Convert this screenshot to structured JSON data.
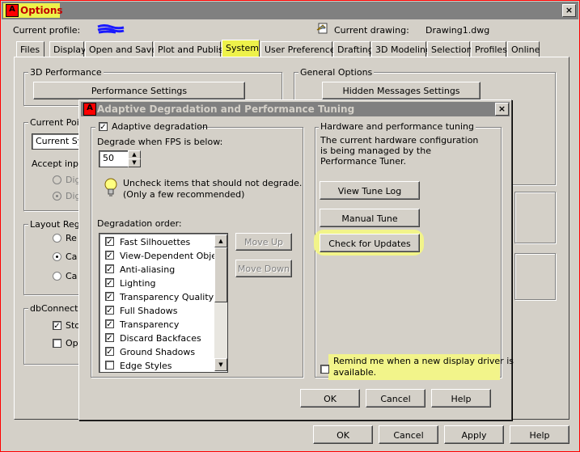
{
  "window": {
    "title": "Options",
    "icon_letter": "A",
    "close_glyph": "×"
  },
  "profile": {
    "label": "Current profile:",
    "current_drawing_label": "Current drawing:",
    "current_drawing_value": "Drawing1.dwg"
  },
  "tabs": [
    {
      "label": "Files",
      "active": false
    },
    {
      "label": "Display",
      "active": false
    },
    {
      "label": "Open and Save",
      "active": false
    },
    {
      "label": "Plot and Publish",
      "active": false
    },
    {
      "label": "System",
      "active": true
    },
    {
      "label": "User Preferences",
      "active": false
    },
    {
      "label": "Drafting",
      "active": false
    },
    {
      "label": "3D Modeling",
      "active": false
    },
    {
      "label": "Selection",
      "active": false
    },
    {
      "label": "Profiles",
      "active": false
    },
    {
      "label": "Online",
      "active": false
    }
  ],
  "system_tab": {
    "perf_group": "3D Performance",
    "perf_settings_btn": "Performance Settings",
    "general_group": "General Options",
    "hidden_messages_btn": "Hidden Messages Settings",
    "current_pointing_group": "Current Poin",
    "current_pointing_value": "Current Sys",
    "accept_input_label": "Accept inpu",
    "accept_opt1": "Dig",
    "accept_opt2": "Dig",
    "layout_group": "Layout Rege",
    "layout_opt1": "Re",
    "layout_opt2": "Ca",
    "layout_opt3": "Ca",
    "dbconnect_group": "dbConnect O",
    "dbconnect_opt1": "Sto",
    "dbconnect_opt2": "Op"
  },
  "dialog": {
    "title": "Adaptive Degradation and Performance Tuning",
    "icon_letter": "A",
    "close_glyph": "×",
    "adaptive_label": "Adaptive degradation",
    "adaptive_checked": true,
    "fps_label": "Degrade when FPS is below:",
    "fps_value": "50",
    "hint_line1": "Uncheck items that should not degrade.",
    "hint_line2": "(Only a few recommended)",
    "order_label": "Degradation order:",
    "items": [
      {
        "label": "Fast Silhouettes",
        "checked": true
      },
      {
        "label": "View-Dependent Objects",
        "checked": true
      },
      {
        "label": "Anti-aliasing",
        "checked": true
      },
      {
        "label": "Lighting",
        "checked": true
      },
      {
        "label": "Transparency Quality",
        "checked": true
      },
      {
        "label": "Full Shadows",
        "checked": true
      },
      {
        "label": "Transparency",
        "checked": true
      },
      {
        "label": "Discard Backfaces",
        "checked": true
      },
      {
        "label": "Ground Shadows",
        "checked": true
      },
      {
        "label": "Edge Styles",
        "checked": false
      }
    ],
    "move_up": "Move Up",
    "move_down": "Move Down",
    "hw_group": "Hardware and performance tuning",
    "hw_line1": "The current hardware configuration",
    "hw_line2": "is being managed by the",
    "hw_line3": "Performance Tuner.",
    "view_log_btn": "View Tune Log",
    "manual_tune_btn": "Manual Tune",
    "check_updates_btn": "Check for Updates",
    "remind_line1": "Remind me when a new display driver is",
    "remind_line2": "available.",
    "remind_checked": false,
    "ok": "OK",
    "cancel": "Cancel",
    "help": "Help"
  },
  "footer": {
    "ok": "OK",
    "cancel": "Cancel",
    "apply": "Apply",
    "help": "Help"
  },
  "colors": {
    "highlight": "#eef24a",
    "chrome": "#d4d0c8",
    "titlebar": "#808080",
    "scribble": "#1a1aff",
    "window_border": "#ff0000"
  }
}
